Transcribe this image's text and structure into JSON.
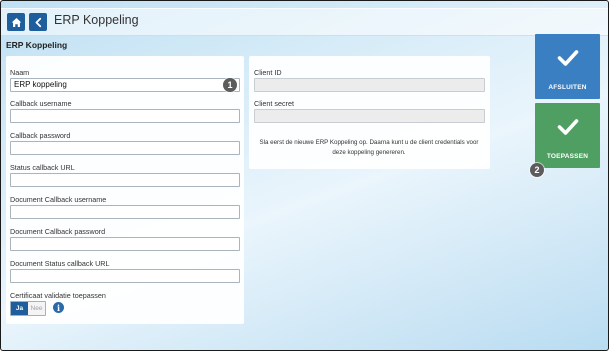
{
  "header": {
    "title": "ERP Koppeling",
    "home_icon": "home-icon",
    "back_icon": "chevron-left-icon"
  },
  "section_title": "ERP Koppeling",
  "form": {
    "naam": {
      "label": "Naam",
      "value": "ERP koppeling"
    },
    "callback_username": {
      "label": "Callback username",
      "value": ""
    },
    "callback_password": {
      "label": "Callback password",
      "value": ""
    },
    "status_callback_url": {
      "label": "Status callback URL",
      "value": ""
    },
    "document_callback_username": {
      "label": "Document Callback username",
      "value": ""
    },
    "document_callback_password": {
      "label": "Document Callback password",
      "value": ""
    },
    "document_status_callback_url": {
      "label": "Document Status callback URL",
      "value": ""
    },
    "certificaat": {
      "label": "Certificaat validatie toepassen",
      "yes": "Ja",
      "no": "Nee",
      "selected": "Ja"
    }
  },
  "credentials": {
    "client_id": {
      "label": "Client ID",
      "value": ""
    },
    "client_secret": {
      "label": "Client secret",
      "value": ""
    },
    "note": "Sla eerst de nieuwe ERP Koppeling op. Daarna kunt u de client credentials voor deze koppeling genereren."
  },
  "actions": {
    "afsluiten": {
      "label": "AFSLUITEN",
      "color": "#3a7fc1"
    },
    "toepassen": {
      "label": "TOEPASSEN",
      "color": "#4f9f62"
    }
  },
  "callouts": {
    "one": "1",
    "two": "2"
  },
  "colors": {
    "nav_button": "#1f5e9c",
    "badge": "#5c5c5c"
  }
}
